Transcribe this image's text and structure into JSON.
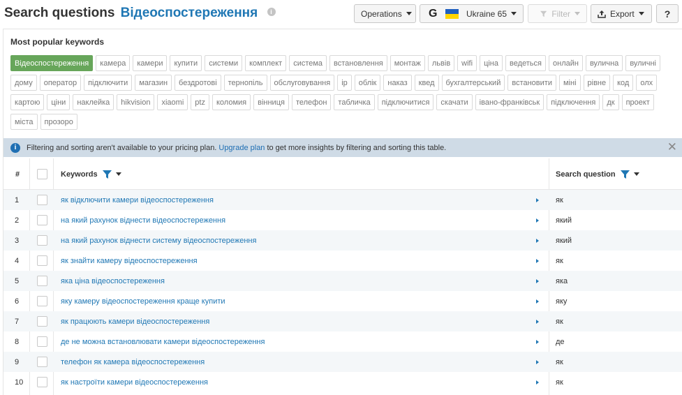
{
  "header": {
    "title": "Search questions",
    "keyword": "Відеоспостереження",
    "operations_label": "Operations",
    "database_label": "Ukraine 65",
    "filter_label": "Filter",
    "export_label": "Export",
    "help_label": "?"
  },
  "popular": {
    "title": "Most popular keywords",
    "tags": [
      "Відеоспостереження",
      "камера",
      "камери",
      "купити",
      "системи",
      "комплект",
      "система",
      "встановлення",
      "монтаж",
      "львів",
      "wifi",
      "ціна",
      "ведеться",
      "онлайн",
      "вулична",
      "вуличні",
      "дому",
      "оператор",
      "підключити",
      "магазин",
      "бездротові",
      "тернопіль",
      "обслуговування",
      "ip",
      "облік",
      "наказ",
      "квед",
      "бухгалтерський",
      "встановити",
      "міні",
      "рівне",
      "код",
      "олх",
      "картою",
      "ціни",
      "наклейка",
      "hikvision",
      "xiaomi",
      "ptz",
      "коломия",
      "вінниця",
      "телефон",
      "табличка",
      "підключитися",
      "скачати",
      "івано-франківськ",
      "підключення",
      "дк",
      "проект",
      "міста",
      "прозоро"
    ]
  },
  "notice": {
    "text_before": "Filtering and sorting aren't available to your pricing plan.",
    "link": "Upgrade plan",
    "text_after": "to get more insights by filtering and sorting this table."
  },
  "table": {
    "col_num": "#",
    "col_keywords": "Keywords",
    "col_question": "Search question",
    "rows": [
      {
        "num": "1",
        "keyword": "як відключити камери відеоспостереження",
        "question": "як"
      },
      {
        "num": "2",
        "keyword": "на який рахунок віднести відеоспостереження",
        "question": "який"
      },
      {
        "num": "3",
        "keyword": "на який рахунок віднести систему відеоспостереження",
        "question": "який"
      },
      {
        "num": "4",
        "keyword": "як знайти камеру відеоспостереження",
        "question": "як"
      },
      {
        "num": "5",
        "keyword": "яка ціна відеоспостереження",
        "question": "яка"
      },
      {
        "num": "6",
        "keyword": "яку камеру відеоспостереження краще купити",
        "question": "яку"
      },
      {
        "num": "7",
        "keyword": "як працюють камери відеоспостереження",
        "question": "як"
      },
      {
        "num": "8",
        "keyword": "де не можна встановлювати камери відеоспостереження",
        "question": "де"
      },
      {
        "num": "9",
        "keyword": "телефон як камера відеоспостереження",
        "question": "як"
      },
      {
        "num": "10",
        "keyword": "як настроїти камери відеоспостереження",
        "question": "як"
      }
    ]
  },
  "colors": {
    "accent": "#1f77b4",
    "tag_active": "#67a65a",
    "notice_bg": "#cfdbe6"
  }
}
